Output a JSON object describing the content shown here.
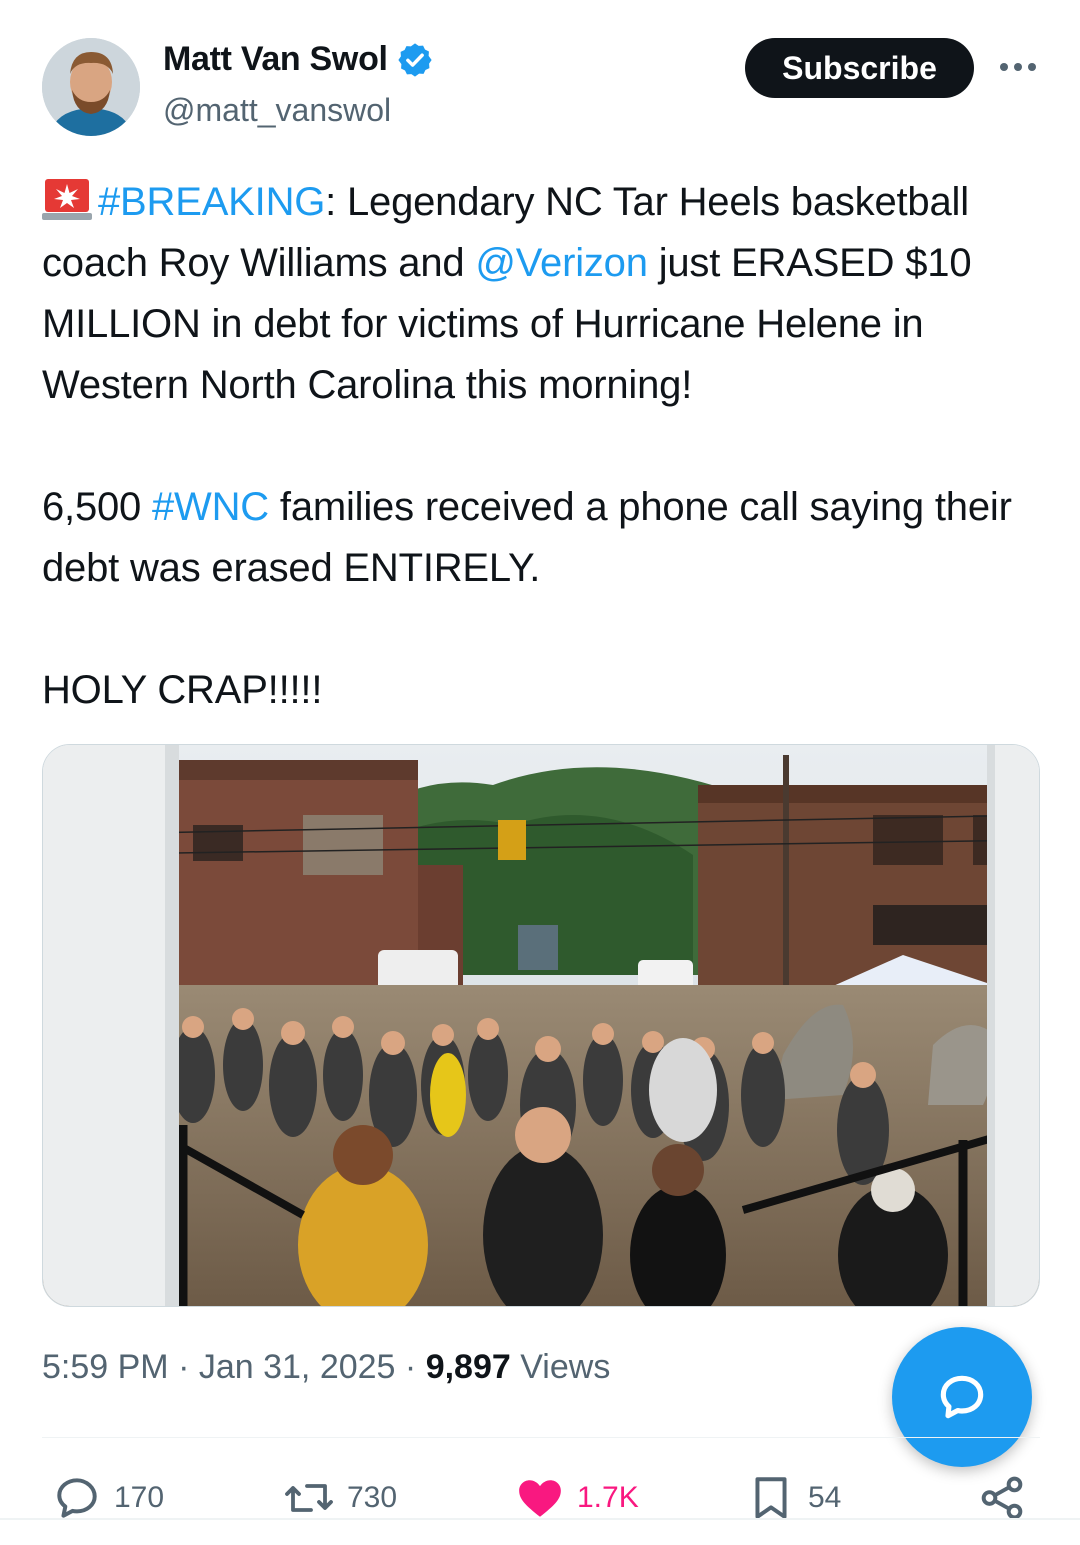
{
  "author": {
    "display_name": "Matt Van Swol",
    "handle": "@matt_vanswol",
    "verified": true
  },
  "header": {
    "subscribe_label": "Subscribe"
  },
  "tweet": {
    "siren_icon": "rotating-light-emoji",
    "line1_hashtag": "#BREAKING",
    "line1_text": ": Legendary NC Tar Heels basketball coach Roy Williams and ",
    "line1_mention": "@Verizon",
    "line1_text_2": " just ERASED $10 MILLION in debt for victims of Hurricane Helene in Western North Carolina this morning!",
    "p2_text_a": "6,500 ",
    "p2_hashtag": "#WNC",
    "p2_text_b": " families received a phone call saying their debt was erased ENTIRELY.",
    "p3_text": "HOLY CRAP!!!!!"
  },
  "meta": {
    "time": "5:59 PM",
    "date": "Jan 31, 2025",
    "views_count": "9,897",
    "views_label": "Views",
    "separator": " · "
  },
  "actions": {
    "replies": "170",
    "reposts": "730",
    "likes": "1.7K",
    "bookmarks": "54"
  },
  "colors": {
    "link": "#1d9bf0",
    "like": "#f91880",
    "text": "#0f1419",
    "secondary": "#536471"
  }
}
